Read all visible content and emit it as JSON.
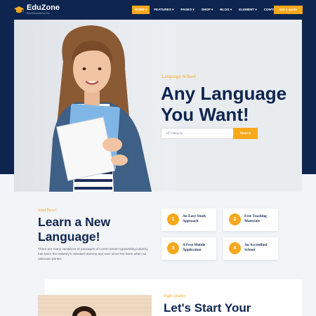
{
  "brand": {
    "name": "EduZone",
    "tagline": "Best Education & Inc.",
    "logo_icon": "graduation-cap-icon"
  },
  "nav": {
    "items": [
      {
        "label": "HOME",
        "active": true
      },
      {
        "label": "FEATURES",
        "active": false
      },
      {
        "label": "PAGES",
        "active": false
      },
      {
        "label": "SHOP",
        "active": false
      },
      {
        "label": "BLOG",
        "active": false
      },
      {
        "label": "ELEMENT",
        "active": false
      },
      {
        "label": "CONTACT US",
        "active": false
      }
    ],
    "cta_label": "Get a quote"
  },
  "hero": {
    "kicker": "Language School",
    "title": "Any Language You Want!",
    "search_placeholder": "All Category",
    "search_button": "Search"
  },
  "learn": {
    "kicker": "Start Now!",
    "title": "Learn a New Language!",
    "text": "There are many variations of passages of Lorem Ipsum typesetting industry has been the industry's standard dummy text ever since the been when an unknown printer.",
    "features": [
      {
        "num": "1",
        "label": "An Easy Study Approach"
      },
      {
        "num": "2",
        "label": "Free Teaching Materials"
      },
      {
        "num": "3",
        "label": "A Free Mobile Application"
      },
      {
        "num": "4",
        "label": "An Accredited School"
      }
    ]
  },
  "next": {
    "kicker": "High Quality",
    "title": "Let's Start Your"
  },
  "colors": {
    "navy": "#0e2550",
    "accent": "#f7a81b",
    "background": "#f2f4f7"
  }
}
